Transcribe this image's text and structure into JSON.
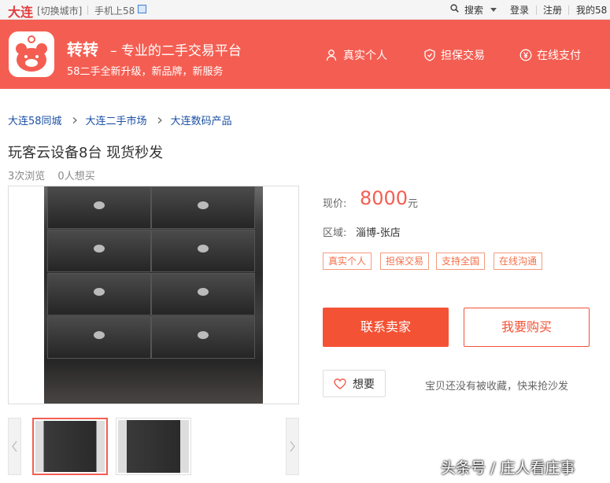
{
  "topbar": {
    "city": "大连",
    "switch_city": "[切换城市]",
    "mobile": "手机上58",
    "search": "搜索",
    "login": "登录",
    "register": "注册",
    "my58": "我的58"
  },
  "banner": {
    "brand": "转转",
    "slogan": "– 专业的二手交易平台",
    "subslogan": "58二手全新升级，新品牌，新服务",
    "features": [
      "真实个人",
      "担保交易",
      "在线支付"
    ],
    "accent": "#f45e52"
  },
  "breadcrumb": [
    "大连58同城",
    "大连二手市场",
    "大连数码产品"
  ],
  "listing": {
    "title": "玩客云设备8台 现货秒发",
    "views": "3次浏览",
    "wants": "0人想买",
    "price_label": "现价:",
    "price": "8000",
    "price_unit": "元",
    "area_label": "区域:",
    "area": "淄博-张店",
    "tags": [
      "真实个人",
      "担保交易",
      "支持全国",
      "在线沟通"
    ],
    "contact_button": "联系卖家",
    "buy_button": "我要购买",
    "want_button": "想要",
    "favorite_note": "宝贝还没有被收藏，快来抢沙发"
  },
  "watermark": "头条号 / 庄人看庄事"
}
